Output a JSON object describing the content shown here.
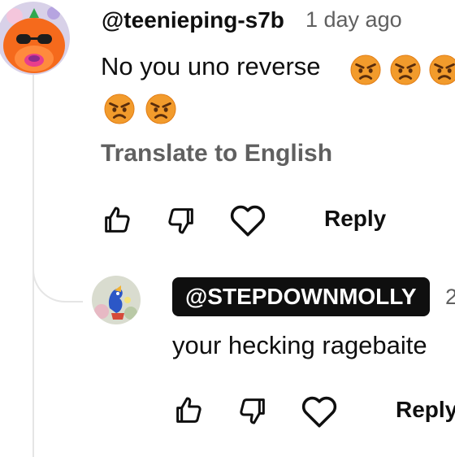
{
  "comment": {
    "author": "@teenieping-s7b",
    "time": "1 day ago",
    "text": "No you uno reverse",
    "emoji": "pouting-face",
    "translate_label": "Translate to English",
    "actions": {
      "like_icon": "thumbs-up-icon",
      "dislike_icon": "thumbs-down-icon",
      "heart_icon": "heart-icon",
      "reply_label": "Reply"
    }
  },
  "reply": {
    "author": "@STEPDOWNMOLLY",
    "time": "2",
    "text": "your hecking ragebaite",
    "actions": {
      "like_icon": "thumbs-up-icon",
      "dislike_icon": "thumbs-down-icon",
      "heart_icon": "heart-icon",
      "reply_label": "Reply"
    }
  },
  "colors": {
    "text": "#0f0f0f",
    "secondary": "#606060",
    "chip_bg": "#0f0f0f",
    "chip_text": "#ffffff",
    "emoji_face": "#f29b2c",
    "emoji_brow": "#5a2d0c",
    "avatar_main": "#f56a1c",
    "avatar_reply_bg": "#d9dccf"
  }
}
